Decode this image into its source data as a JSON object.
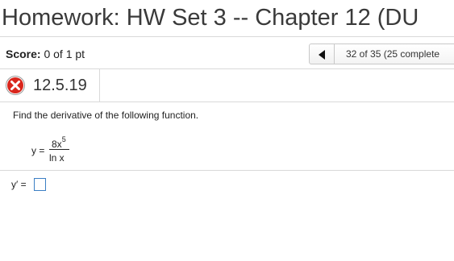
{
  "page": {
    "title": "Homework: HW Set 3 -- Chapter 12 (DU"
  },
  "score": {
    "label": "Score:",
    "value": "0 of 1 pt"
  },
  "navigation": {
    "prev_icon": "left-triangle-icon",
    "status": "32 of 35 (25 complete"
  },
  "question": {
    "status_icon": "red-x-icon",
    "number": "12.5.19",
    "prompt": "Find the derivative of the following function.",
    "equation": {
      "lhs": "y =",
      "numerator": "8x",
      "exponent": "5",
      "denominator": "ln x"
    },
    "answer_label": "y′ =",
    "answer_value": ""
  },
  "colors": {
    "error_red": "#d9261c",
    "input_border": "#3b7fc4",
    "divider": "#d9d9d9"
  }
}
